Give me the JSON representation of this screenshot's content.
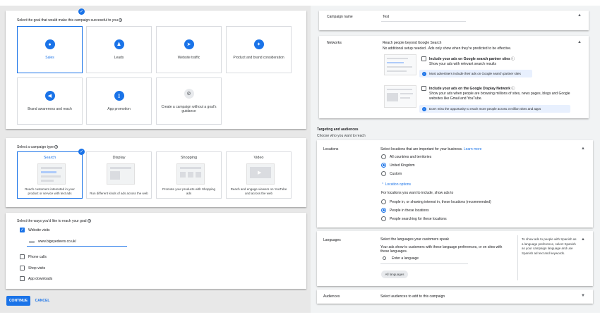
{
  "goal_section": {
    "prompt": "Select the goal that would make this campaign successful to you",
    "goals": [
      {
        "label": "Sales",
        "icon": "tag-icon",
        "glyph": "●"
      },
      {
        "label": "Leads",
        "icon": "people-icon",
        "glyph": "♟"
      },
      {
        "label": "Website traffic",
        "icon": "cursor-icon",
        "glyph": "➤"
      },
      {
        "label": "Product and brand consideration",
        "icon": "share-icon",
        "glyph": "✦"
      },
      {
        "label": "Brand awareness and reach",
        "icon": "megaphone-icon",
        "glyph": "◀"
      },
      {
        "label": "App promotion",
        "icon": "phone-icon",
        "glyph": "▯"
      },
      {
        "label": "Create a campaign without a goal's guidance",
        "icon": "gear-icon",
        "glyph": "⚙"
      }
    ]
  },
  "type_section": {
    "prompt": "Select a campaign type",
    "types": [
      {
        "name": "Search",
        "desc": "Reach customers interested in your product or service with text ads"
      },
      {
        "name": "Display",
        "desc": "Run different kinds of ads across the web"
      },
      {
        "name": "Shopping",
        "desc": "Promote your products with Shopping ads"
      },
      {
        "name": "Video",
        "desc": "Reach and engage viewers on YouTube and across the web"
      }
    ]
  },
  "ways_section": {
    "prompt": "Select the ways you'd like to reach your goal",
    "website_visits": "Website visits",
    "url": "www.bigeyedeers.co.uk/",
    "phone_calls": "Phone calls",
    "shop_visits": "Shop visits",
    "app_downloads": "App downloads"
  },
  "buttons": {
    "continue": "CONTINUE",
    "cancel": "CANCEL"
  },
  "campaign_name": {
    "label": "Campaign name",
    "value": "Test"
  },
  "networks": {
    "label": "Networks",
    "intro1": "Reach people beyond Google Search",
    "intro2": "No additional setup needed . Ads only show when they're predicted to be effective.",
    "search_partners_title": "Include your ads on Google search partner sites",
    "search_partners_desc": "Show your ads with relevant search results",
    "search_partners_info": "Most advertisers include their ads on Google search partner sites",
    "display_title": "Include your ads on the Google Display Network",
    "display_desc1": "Show your ads when people are browsing millions of sites, news pages, blogs and Google",
    "display_desc2": "websites like Gmail and YouTube.",
    "display_info": "Don't miss the opportunity to reach more people across 3 million sites and apps"
  },
  "targeting": {
    "title": "Targeting and audiences",
    "subtitle": "Choose who you want to reach"
  },
  "locations": {
    "label": "Locations",
    "prompt": "Select locations that are important for your business.",
    "learn_more": "Learn more",
    "options": [
      "All countries and territories",
      "United Kingdom",
      "Custom"
    ],
    "location_options": "Location options",
    "include_text": "For locations you want to include, show ads to",
    "include_options": [
      "People in, or showing interest in, these locations (recommended)",
      "People in these locations",
      "People searching for these locations"
    ]
  },
  "languages": {
    "label": "Languages",
    "prompt": "Select the languages your customers speak",
    "desc1": "Your ads show to customers with these language preferences, or on sites with",
    "desc2": "these languages.",
    "search_placeholder": "Enter a language",
    "chip": "All languages",
    "help": "To show ads to people with Spanish as a language preference, select Spanish as your campaign language and use Spanish ad text and keywords."
  },
  "audiences": {
    "label": "Audiences",
    "prompt": "Select audiences to add to this campaign"
  }
}
